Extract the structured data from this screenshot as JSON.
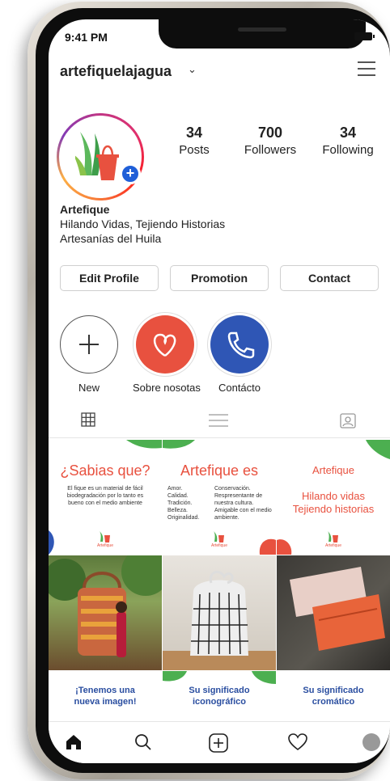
{
  "status": {
    "time": "9:41 PM"
  },
  "profile": {
    "username": "artefiquelajagua",
    "stats": [
      {
        "value": "34",
        "label": "Posts"
      },
      {
        "value": "700",
        "label": "Followers"
      },
      {
        "value": "34",
        "label": "Following"
      }
    ],
    "bio": {
      "name": "Artefique",
      "line1": "Hilando Vidas, Tejiendo Historias",
      "line2": "Artesanías del Huila"
    }
  },
  "buttons": {
    "edit": "Edit Profile",
    "promotion": "Promotion",
    "contact": "Contact"
  },
  "highlights": [
    {
      "label": "New"
    },
    {
      "label": "Sobre nosotas"
    },
    {
      "label": "Contácto"
    }
  ],
  "posts": {
    "p1": {
      "title": "¿Sabias que?",
      "body": "El fique es un material de fácil biodegradación por lo tanto es bueno con el medio ambiente",
      "brand": "Artefique"
    },
    "p2": {
      "title": "Artefique es",
      "col1": [
        "Amor.",
        "Calidad.",
        "Tradición.",
        "Belleza.",
        "Originalidad."
      ],
      "col2": [
        "Conservación.",
        "Respresentante de nuestra cultura.",
        "Amigable con el medio ambiente."
      ],
      "brand": "Artefique"
    },
    "p3": {
      "title": "Artefique",
      "line1": "Hilando vidas",
      "line2": "Tejiendo historias",
      "brand": "Artefique"
    },
    "p7": {
      "line1": "¡Tenemos una",
      "line2": "nueva imagen!"
    },
    "p8": {
      "line1": "Su significado",
      "line2": "iconográfico"
    },
    "p9": {
      "line1": "Su significado",
      "line2": "cromático"
    }
  },
  "colors": {
    "accent_red": "#e8513f",
    "brand_green": "#4caf50",
    "brand_blue": "#1f5fd8",
    "text_blue": "#2a4ea0"
  }
}
